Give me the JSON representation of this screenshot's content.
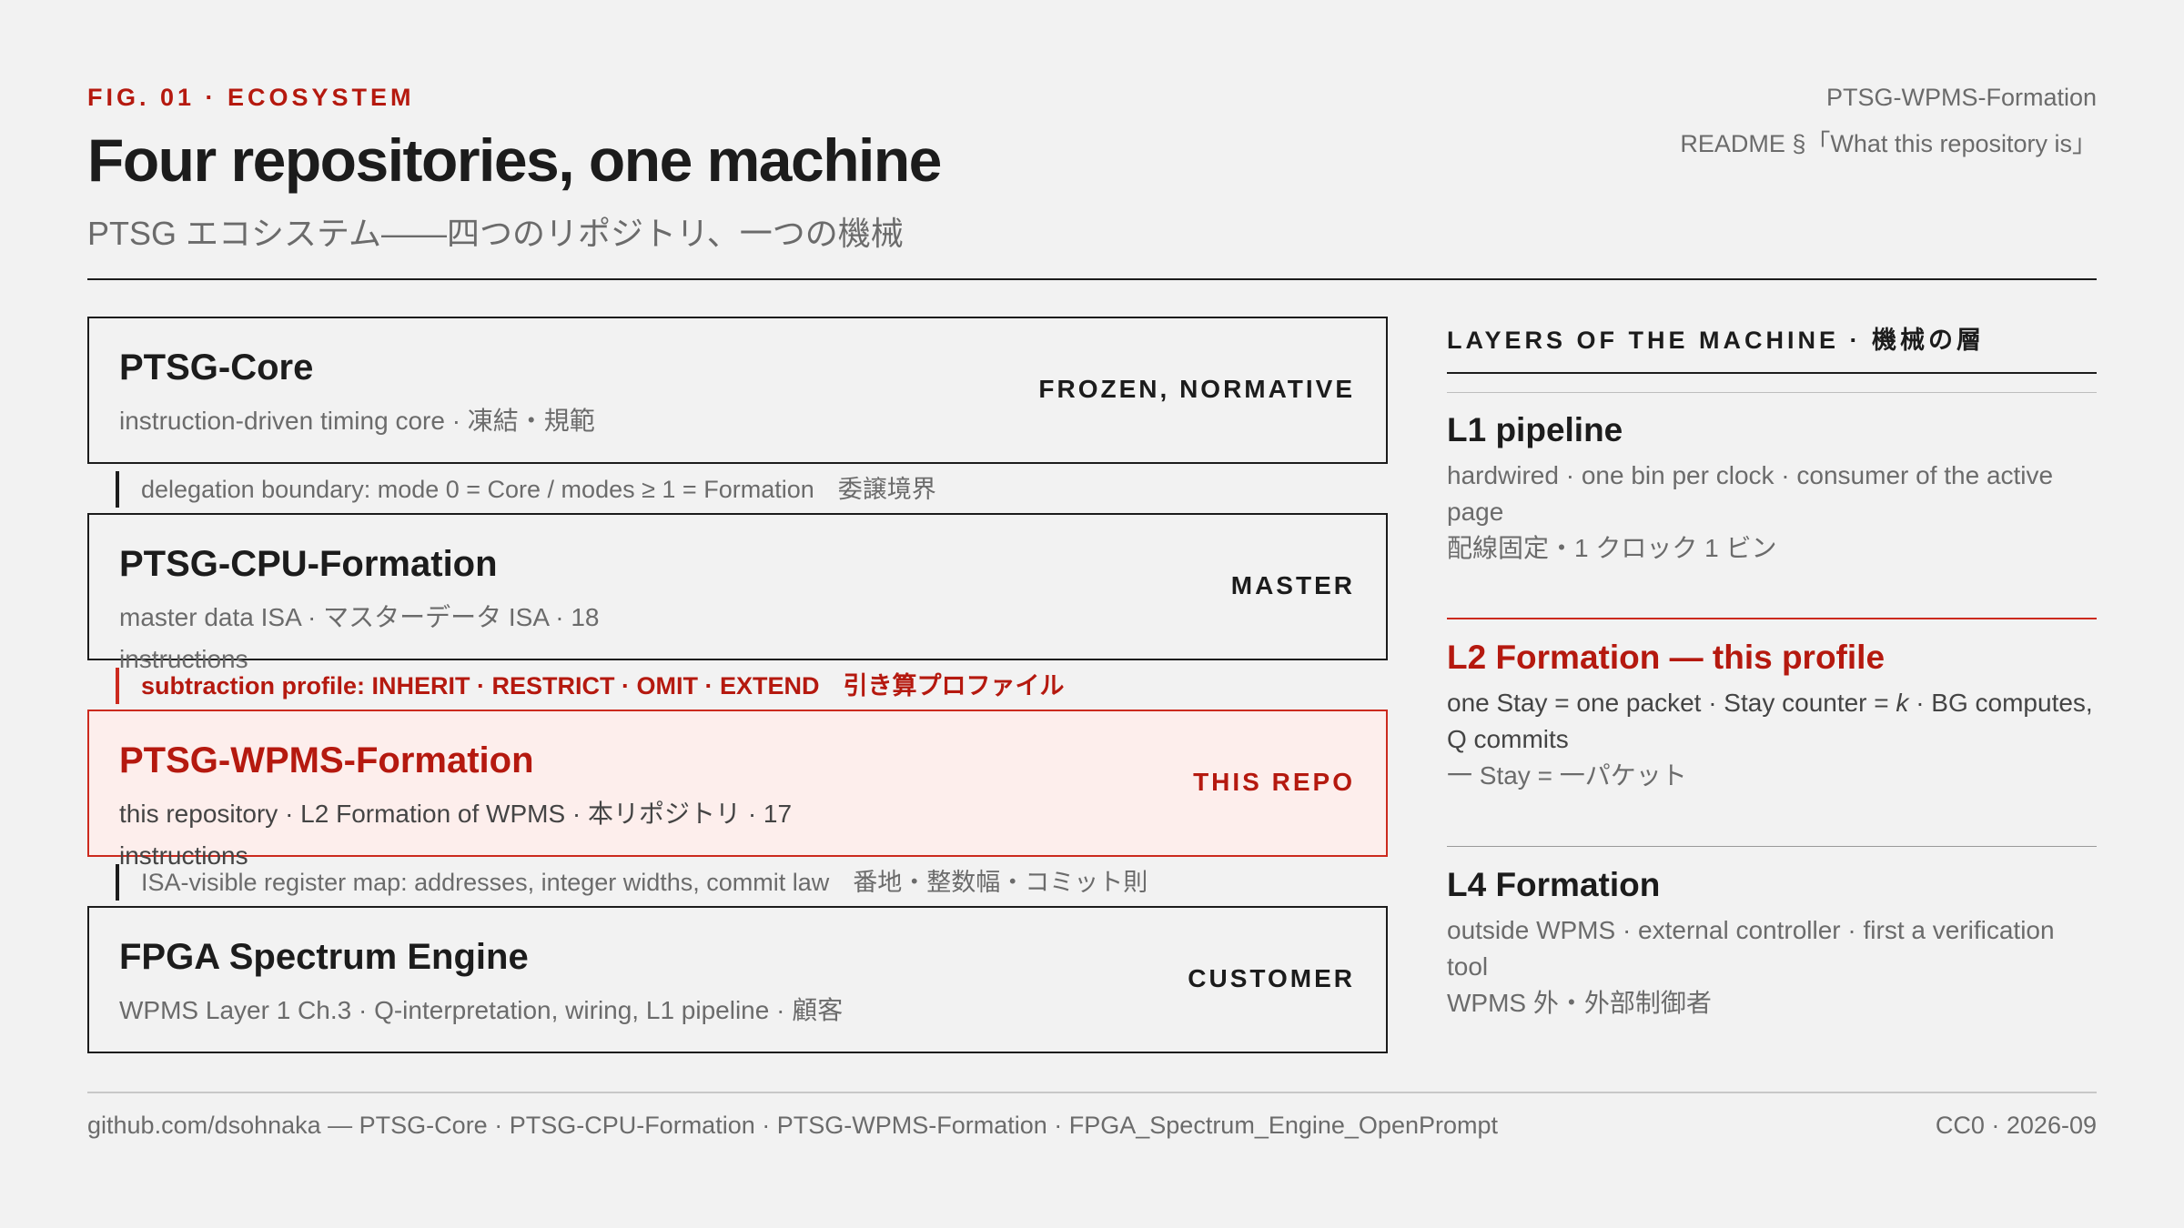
{
  "header": {
    "fig_label": "FIG. 01 · ECOSYSTEM",
    "title": "Four repositories, one machine",
    "subtitle": "PTSG エコシステム——四つのリポジトリ、一つの機械",
    "meta_repo": "PTSG-WPMS-Formation",
    "meta_readme": "README §「What this repository is」"
  },
  "repos": [
    {
      "name": "PTSG-Core",
      "desc": "instruction-driven timing core · 凍結・規範",
      "tag": "FROZEN, NORMATIVE"
    },
    {
      "name": "PTSG-CPU-Formation",
      "desc": "master data ISA · マスターデータ ISA · 18 instructions",
      "tag": "MASTER"
    },
    {
      "name": "PTSG-WPMS-Formation",
      "desc": "this repository · L2 Formation of WPMS · 本リポジトリ · 17 instructions",
      "tag": "THIS REPO"
    },
    {
      "name": "FPGA Spectrum Engine",
      "desc": "WPMS Layer 1 Ch.3 · Q-interpretation, wiring, L1 pipeline · 顧客",
      "tag": "CUSTOMER"
    }
  ],
  "connectors": [
    {
      "text": "delegation boundary: mode 0 = Core / modes ≥ 1 = Formation",
      "jp": "委譲境界"
    },
    {
      "text": "subtraction profile: INHERIT · RESTRICT · OMIT · EXTEND",
      "jp": "引き算プロファイル"
    },
    {
      "text": "ISA-visible register map: addresses, integer widths, commit law",
      "jp": "番地・整数幅・コミット則"
    }
  ],
  "layers": {
    "heading": "LAYERS OF THE MACHINE · 機械の層",
    "items": [
      {
        "title": "L1 pipeline",
        "desc": "hardwired · one bin per clock · consumer of the active page",
        "jp": "配線固定・1 クロック 1 ビン"
      },
      {
        "title": "L2 Formation — this profile",
        "desc_a": "one Stay = one packet · Stay counter = ",
        "desc_k": "k",
        "desc_b": " · BG computes, Q commits",
        "jp": "一 Stay = 一パケット"
      },
      {
        "title": "L4 Formation",
        "desc": "outside WPMS · external controller · first a verification tool",
        "jp": "WPMS 外・外部制御者"
      }
    ]
  },
  "footer": {
    "left": "github.com/dsohnaka — PTSG-Core · PTSG-CPU-Formation · PTSG-WPMS-Formation · FPGA_Spectrum_Engine_OpenPrompt",
    "right": "CC0 · 2026-09"
  },
  "colors": {
    "accent": "#b5190f",
    "accent_border": "#cc2a1e",
    "current_fill": "#fdeeec",
    "ink": "#1c1c1c",
    "muted": "#6b6b6b",
    "background": "#f2f2f2"
  }
}
